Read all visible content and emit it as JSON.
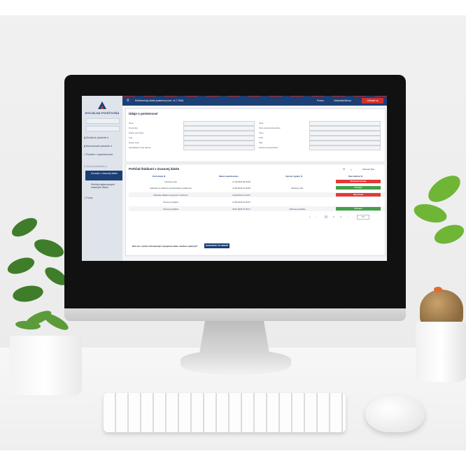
{
  "app": {
    "title": "Elektronický sklad poistenca (ver. v1.7.990)",
    "logo_text": "SOCIÁLNA POISŤOVŇA",
    "top_links": [
      "Pomoc",
      "Zahraničia/Izbora"
    ],
    "logout": "Odhlásiť sa"
  },
  "sidebar": {
    "items": [
      {
        "label": "Dlžníkové poistenie",
        "icon": "shield-icon"
      },
      {
        "label": "Nemocenské poistenie",
        "icon": "medical-icon"
      },
      {
        "label": "Podanie v nepamenovaní",
        "icon": "document-icon"
      },
      {
        "label": "Úrazové poistenie",
        "icon": "document-icon"
      }
    ],
    "active": "Konania o úrazovej dávke",
    "sub": "Prehľad registrovaných úrazových dávok",
    "forms": "Formy"
  },
  "personal": {
    "title": "Údaje o poistencovi",
    "left_labels": [
      "Meno",
      "Priezvisko",
      "Rodné priezvisko",
      "Titul",
      "Rodné číslo",
      "Identifikačné číslo klienta"
    ],
    "right_labels": [
      "Ulica",
      "Číslo súpisné/orientačné",
      "Obec",
      "PSČ",
      "Štát",
      "Rodinný stav/pohlavie"
    ]
  },
  "benefits": {
    "title": "Prehľad štádiumí v úrazovej dávke",
    "actions": [
      "Zobraziť filter"
    ],
    "columns": [
      "Druh dávky",
      "Dátum zaevidovania",
      "Spôsob výplaty",
      "Stav dávkoví"
    ],
    "rows": [
      {
        "type": "Úrazová renta",
        "date": "17.05.2023 06:09:56",
        "payment": "",
        "status": "Zastavené konanie",
        "status_color": "#e53935"
      },
      {
        "type": "Náhrada za sťaženie spoločenského uplatnenia",
        "date": "16.08.2023 12:25:86",
        "payment": "Bankový účet",
        "status": "Priznaná",
        "status_color": "#43a047"
      },
      {
        "type": "Náhrada nákladov spojených s liečením",
        "date": "16.08.2023 12:19:57",
        "payment": "",
        "status": "Nepriznaná",
        "status_color": "#e53935"
      },
      {
        "type": "Úrazový príplatok",
        "date": "16.08.2023 10:54:51",
        "payment": "",
        "status": "",
        "status_color": ""
      },
      {
        "type": "Úrazový príplatok",
        "date": "28.07.2023 07:09:17",
        "payment": "Poštová poukážka",
        "status": "Priznaná",
        "status_color": "#43a047"
      }
    ],
    "pagination": {
      "prev": "‹",
      "first": "«",
      "pages": [
        "1",
        "2",
        "3"
      ],
      "next": "›",
      "last": "»",
      "page_size": "5"
    }
  },
  "feedback": {
    "question": "Boli ste s týmto informačným zapojením alebo službou spokojní?",
    "button": "NAVRHNITE ČO ZMENIŤ"
  }
}
